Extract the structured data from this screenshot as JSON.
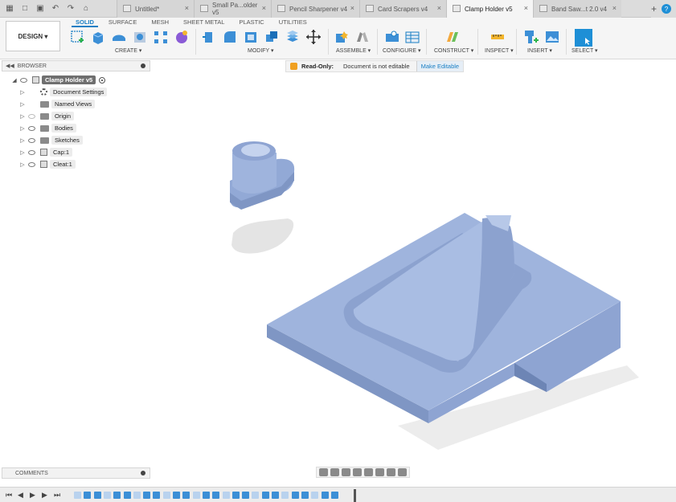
{
  "tabs": [
    {
      "label": "Untitled*",
      "active": false
    },
    {
      "label": "Small Pa...older v5",
      "active": false
    },
    {
      "label": "Pencil Sharpener v4",
      "active": false
    },
    {
      "label": "Card Scrapers v4",
      "active": false
    },
    {
      "label": "Clamp Holder v5",
      "active": true
    },
    {
      "label": "Band Saw...t 2.0 v4",
      "active": false
    }
  ],
  "toolbar": {
    "design_label": "DESIGN ▾",
    "workspace_tabs": [
      "SOLID",
      "SURFACE",
      "MESH",
      "SHEET METAL",
      "PLASTIC",
      "UTILITIES"
    ],
    "groups": {
      "create": "CREATE ▾",
      "modify": "MODIFY ▾",
      "assemble": "ASSEMBLE ▾",
      "configure": "CONFIGURE ▾",
      "construct": "CONSTRUCT ▾",
      "inspect": "INSPECT ▾",
      "insert": "INSERT ▾",
      "select": "SELECT ▾"
    }
  },
  "browser": {
    "title": "BROWSER",
    "root": "Clamp Holder v5",
    "items": [
      "Document Settings",
      "Named Views",
      "Origin",
      "Bodies",
      "Sketches",
      "Cap:1",
      "Cleat:1"
    ]
  },
  "banner": {
    "title": "Read-Only:",
    "message": "Document is not editable",
    "button": "Make Editable"
  },
  "comments": {
    "title": "COMMENTS"
  },
  "colors": {
    "accent": "#1a7fc4",
    "model_face": "#9fb4dd",
    "model_side": "#7f96c4"
  }
}
